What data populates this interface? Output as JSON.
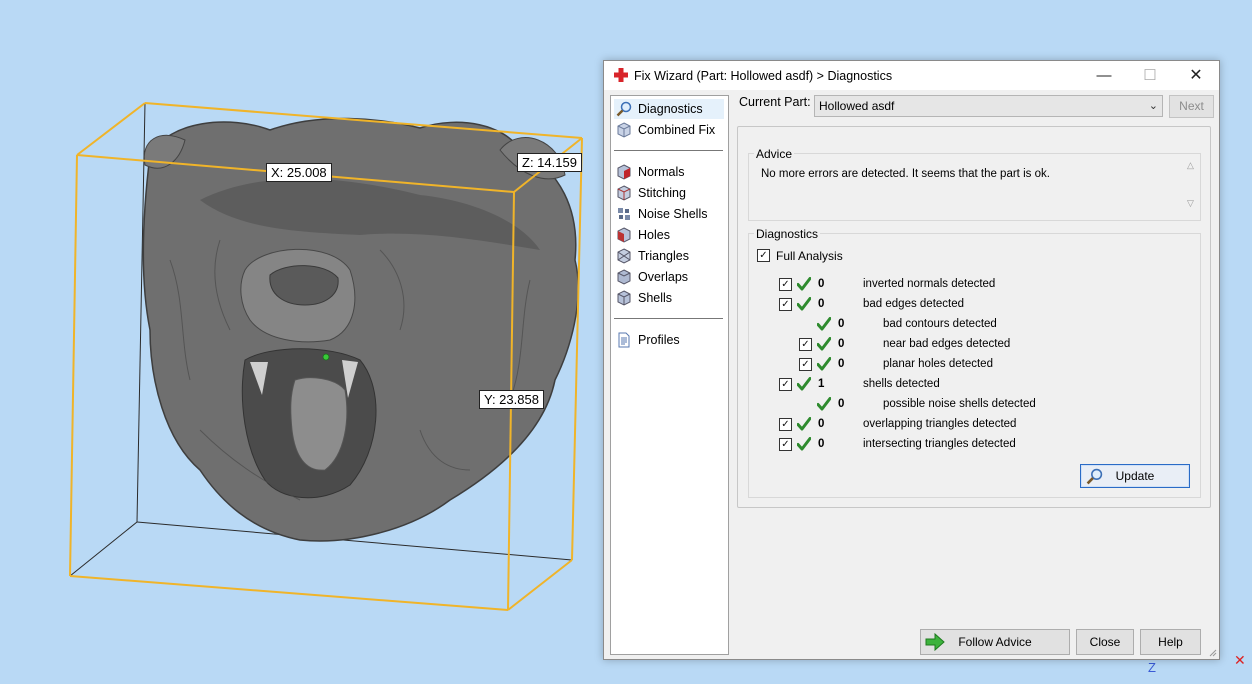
{
  "viewport": {
    "dim_x": "X: 25.008",
    "dim_y": "Y: 23.858",
    "dim_z": "Z: 14.159",
    "axis_z_label": "Z",
    "colors": {
      "background": "#b9d9f5",
      "bounding_box": "#f0b429",
      "model": "#6b6b6b"
    }
  },
  "dialog": {
    "title": "Fix Wizard (Part: Hollowed asdf) > Diagnostics",
    "title_icon": "red-cross-icon",
    "window_buttons": {
      "minimize": "—",
      "maximize": "☐",
      "close": "✕"
    },
    "nav": {
      "items_top": [
        {
          "label": "Diagnostics",
          "icon": "magnifier-icon",
          "selected": true
        },
        {
          "label": "Combined Fix",
          "icon": "cube-icon"
        }
      ],
      "items_mid": [
        {
          "label": "Normals",
          "icon": "normals-cube-icon"
        },
        {
          "label": "Stitching",
          "icon": "stitching-cube-icon"
        },
        {
          "label": "Noise Shells",
          "icon": "noise-shells-icon"
        },
        {
          "label": "Holes",
          "icon": "holes-cube-icon"
        },
        {
          "label": "Triangles",
          "icon": "triangles-cube-icon"
        },
        {
          "label": "Overlaps",
          "icon": "overlaps-cube-icon"
        },
        {
          "label": "Shells",
          "icon": "shells-cube-icon"
        }
      ],
      "items_bottom": [
        {
          "label": "Profiles",
          "icon": "document-icon"
        }
      ]
    },
    "current_part": {
      "label": "Current Part:",
      "value": "Hollowed asdf"
    },
    "next_label": "Next",
    "advice": {
      "title": "Advice",
      "text": "No more errors are detected. It seems that the part is ok."
    },
    "diagnostics": {
      "title": "Diagnostics",
      "full_analysis_label": "Full Analysis",
      "full_analysis_checked": true,
      "rows": [
        {
          "checkbox": true,
          "count": "0",
          "text": "inverted normals detected",
          "indent": 0
        },
        {
          "checkbox": true,
          "count": "0",
          "text": "bad edges detected",
          "indent": 0
        },
        {
          "checkbox": false,
          "count": "0",
          "text": "bad contours detected",
          "indent": 1
        },
        {
          "checkbox": true,
          "count": "0",
          "text": "near bad edges detected",
          "indent": 1
        },
        {
          "checkbox": true,
          "count": "0",
          "text": "planar holes detected",
          "indent": 1
        },
        {
          "checkbox": true,
          "count": "1",
          "text": "shells detected",
          "indent": 0
        },
        {
          "checkbox": false,
          "count": "0",
          "text": "possible noise shells detected",
          "indent": 1
        },
        {
          "checkbox": true,
          "count": "0",
          "text": "overlapping triangles detected",
          "indent": 0
        },
        {
          "checkbox": true,
          "count": "0",
          "text": "intersecting triangles detected",
          "indent": 0
        }
      ],
      "update_label": "Update",
      "ok_color": "#2e8b2e"
    },
    "buttons": {
      "follow_advice": "Follow Advice",
      "close": "Close",
      "help": "Help"
    }
  }
}
